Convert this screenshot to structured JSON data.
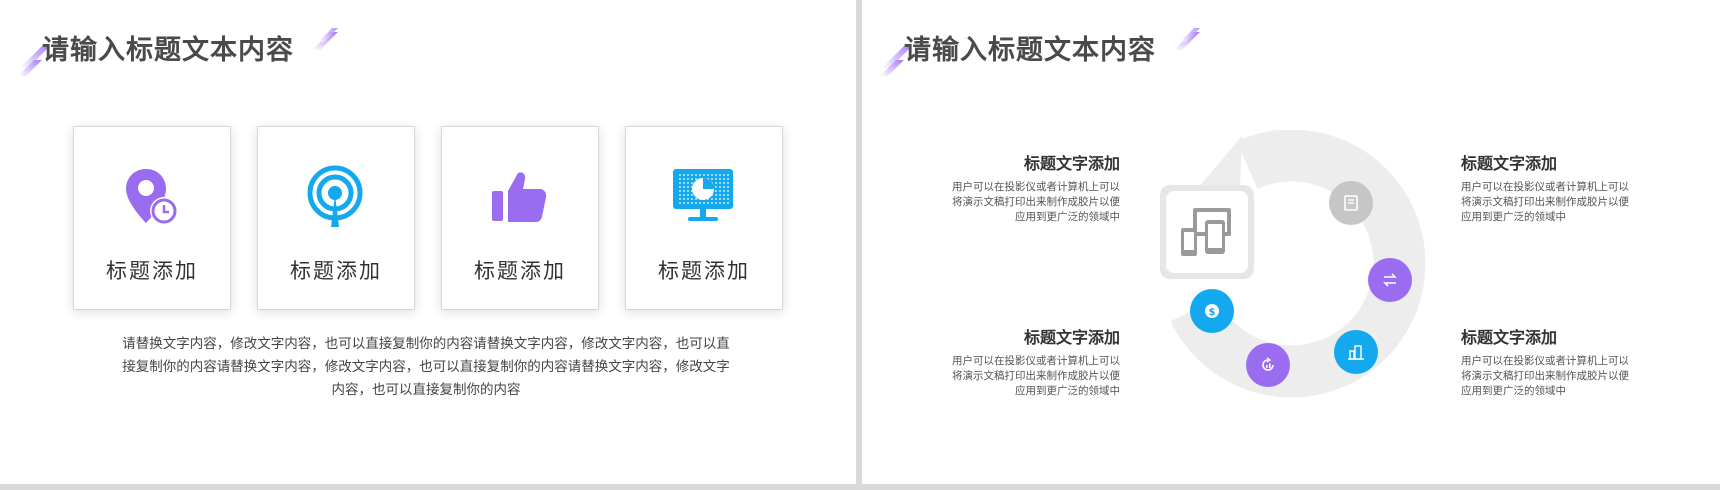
{
  "left_slide": {
    "title": "请输入标题文本内容",
    "cards": [
      {
        "label": "标题添加",
        "icon": "location-clock-icon"
      },
      {
        "label": "标题添加",
        "icon": "broadcast-icon"
      },
      {
        "label": "标题添加",
        "icon": "thumbs-up-icon"
      },
      {
        "label": "标题添加",
        "icon": "monitor-pie-chart-icon"
      }
    ],
    "paragraph": "请替换文字内容，修改文字内容，也可以直接复制你的内容请替换文字内容，修改文字内容，也可以直接复制你的内容请替换文字内容，修改文字内容，也可以直接复制你的内容请替换文字内容，修改文字内容，也可以直接复制你的内容"
  },
  "right_slide": {
    "title": "请输入标题文本内容",
    "items": [
      {
        "heading": "标题文字添加",
        "desc": "用户可以在投影仪或者计算机上可以将演示文稿打印出来制作成胶片以便应用到更广泛的领域中"
      },
      {
        "heading": "标题文字添加",
        "desc": "用户可以在投影仪或者计算机上可以将演示文稿打印出来制作成胶片以便应用到更广泛的领域中"
      },
      {
        "heading": "标题文字添加",
        "desc": "用户可以在投影仪或者计算机上可以将演示文稿打印出来制作成胶片以便应用到更广泛的领域中"
      },
      {
        "heading": "标题文字添加",
        "desc": "用户可以在投影仪或者计算机上可以将演示文稿打印出来制作成胶片以便应用到更广泛的领域中"
      }
    ],
    "center_icon": "devices-icon",
    "cycle_icons": [
      "notebook-icon",
      "exchange-icon",
      "building-icon",
      "refresh-chart-icon",
      "dollar-icon"
    ]
  },
  "colors": {
    "purple": "#9a6cf0",
    "blue": "#14a9ee",
    "gray": "#c6c6c6",
    "arrow": "#ededed",
    "title": "#4a4a4a"
  }
}
